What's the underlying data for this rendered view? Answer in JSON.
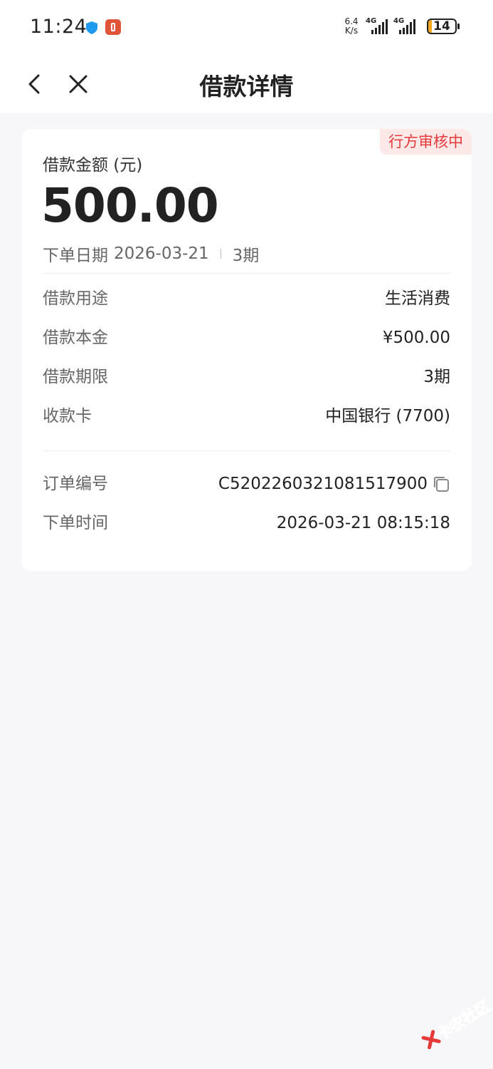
{
  "status_bar": {
    "time": "11:24",
    "net_speed_value": "6.4",
    "net_speed_unit": "K/s",
    "signal_1_label": "4G",
    "signal_2_label": "4G",
    "battery_level": "14",
    "battery_fraction": 0.14
  },
  "nav": {
    "title": "借款详情",
    "back_icon": "chevron-left-icon",
    "close_icon": "close-icon"
  },
  "loan": {
    "status_badge": "行方审核中",
    "amount_label": "借款金额 (元)",
    "amount": "500.00",
    "order_date_label": "下单日期",
    "order_date": "2026-03-21",
    "periods": "3期",
    "details": [
      {
        "label": "借款用途",
        "value": "生活消费"
      },
      {
        "label": "借款本金",
        "value": "¥500.00"
      },
      {
        "label": "借款期限",
        "value": "3期"
      },
      {
        "label": "收款卡",
        "value": "中国银行 (7700)"
      }
    ],
    "order_no_label": "订单编号",
    "order_no": "C5202260321081517900",
    "order_time_label": "下单时间",
    "order_time": "2026-03-21 08:15:18"
  },
  "watermark": {
    "text": "卡农社区"
  },
  "colors": {
    "accent_red": "#e5393a",
    "badge_bg": "#fde8e8",
    "page_bg": "#f7f7f9",
    "battery_fill": "#f5a623"
  }
}
